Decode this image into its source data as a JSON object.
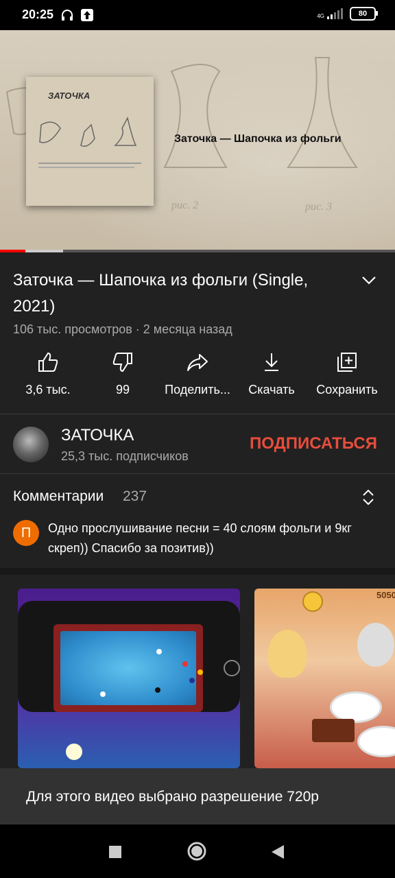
{
  "status_bar": {
    "time": "20:25",
    "network": "4G",
    "battery": "80"
  },
  "video": {
    "overlay_title": "Заточка — Шапочка из фольги",
    "cover_title": "ЗАТОЧКА",
    "progress_fraction": 0.065,
    "buffered_fraction": 0.16
  },
  "details": {
    "title": "Заточка — Шапочка из фольги (Single, 2021)",
    "meta": "106 тыс. просмотров · 2 месяца назад"
  },
  "actions": [
    {
      "label": "3,6 тыс.",
      "icon": "thumbs-up-icon"
    },
    {
      "label": "99",
      "icon": "thumbs-down-icon"
    },
    {
      "label": "Поделить...",
      "icon": "share-icon"
    },
    {
      "label": "Скачать",
      "icon": "download-icon"
    },
    {
      "label": "Сохранить",
      "icon": "add-to-playlist-icon"
    }
  ],
  "channel": {
    "name": "ЗАТОЧКА",
    "subscribers": "25,3 тыс. подписчиков",
    "subscribe_label": "ПОДПИСАТЬСЯ"
  },
  "comments": {
    "title": "Комментарии",
    "count": "237",
    "top_comment": {
      "avatar_letter": "П",
      "text": "Одно прослушивание песни = 40 слоям фольги и 9кг скреп)) Спасибо за позитив))"
    }
  },
  "ads": {
    "card2_coins": "5050"
  },
  "toast": {
    "text": "Для этого видео выбрано разрешение 720p"
  },
  "colors": {
    "background": "#212121",
    "accent_red": "#ff0000",
    "subscribe": "#e84d3c",
    "comment_avatar": "#ef6c00"
  }
}
